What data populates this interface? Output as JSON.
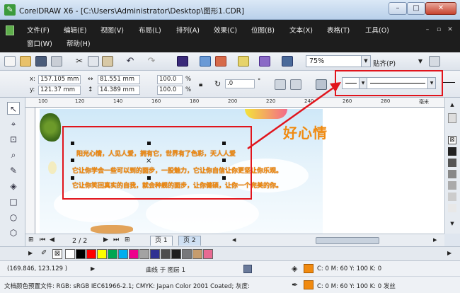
{
  "window": {
    "title": "CorelDRAW X6 - [C:\\Users\\Administrator\\Desktop\\图形1.CDR]",
    "min_glyph": "–",
    "max_glyph": "□",
    "close_glyph": "✕"
  },
  "menu": {
    "row1": [
      "文件(F)",
      "编辑(E)",
      "视图(V)",
      "布局(L)",
      "排列(A)",
      "效果(C)",
      "位图(B)",
      "文本(X)",
      "表格(T)",
      "工具(O)"
    ],
    "row2": [
      "窗口(W)",
      "帮助(H)"
    ]
  },
  "toolbar": {
    "zoom": "75%",
    "snap": "贴齐(P)"
  },
  "property_bar": {
    "x_label": "x:",
    "x_value": "157.105 mm",
    "y_label": "y:",
    "y_value": "121.37 mm",
    "w_value": "81.551 mm",
    "h_value": "14.389 mm",
    "scale_w": "100.0",
    "scale_h": "100.0",
    "pct": "%",
    "angle": ".0",
    "deg": "°"
  },
  "ruler": {
    "h_ticks": [
      "100",
      "120",
      "140",
      "160",
      "180",
      "200",
      "220",
      "240",
      "260",
      "280"
    ],
    "h_unit": "毫米"
  },
  "canvas": {
    "heading": "好心情",
    "lines": [
      "阳光心情，人见人爱，拥有它，世界有了色彩，天人人爱",
      "它让你学会一些可以到的面步，一股魅力，它让你自信让你更坚让你乐观。",
      "它让你笑回真实的自我，就会种舰的面步，让你健硕，让你一个完美的你。"
    ]
  },
  "page_nav": {
    "counter": "2 / 2",
    "tabs": [
      "页 1",
      "页 2"
    ]
  },
  "palette": {
    "colors": [
      "#ffffff",
      "#000000",
      "#ff0000",
      "#ffff00",
      "#00a651",
      "#00aeef",
      "#ed008c",
      "#a3a3a3",
      "#2e3192",
      "#4d4d4d",
      "#1e1e1e",
      "#77787b",
      "#c69c6d",
      "#e86a92"
    ]
  },
  "status": {
    "coords": "(169.846, 123.129 )",
    "layer": "曲线 于 图层 1",
    "fill_swatch": "#f08a10",
    "fill_text": "C: 0 M: 60 Y: 100 K: 0",
    "outline_text": "C: 0 M: 60 Y: 100 K: 0 发丝",
    "profile": "文档颜色预置文件: RGB: sRGB IEC61966-2.1; CMYK: Japan Color 2001 Coated; 灰度: "
  },
  "colors": {
    "accent_red": "#e1141c",
    "text_orange": "#f08a10",
    "menubar": "#1d1d1d"
  }
}
